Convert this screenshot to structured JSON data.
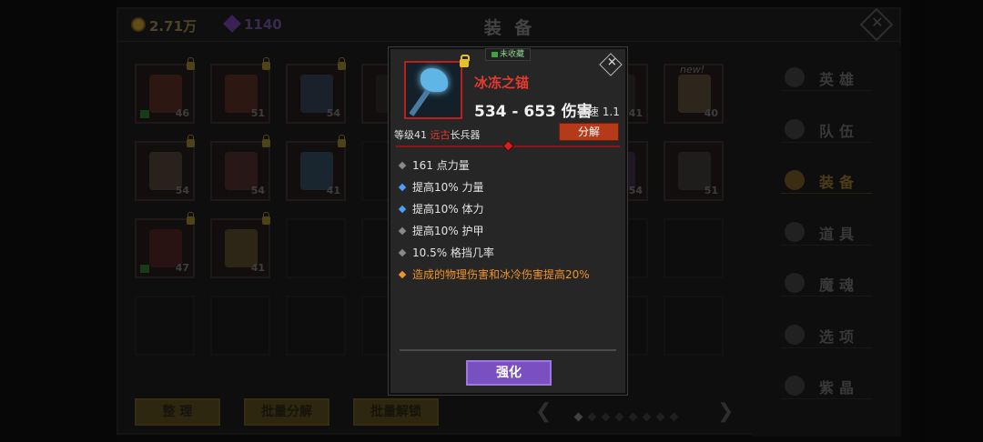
{
  "header": {
    "gold": "2.71万",
    "gems": "1140",
    "title": "装 备"
  },
  "inventory": {
    "slots": [
      {
        "level": "46",
        "locked": true,
        "fav": true,
        "color": "#7a3a2a"
      },
      {
        "level": "51",
        "locked": true,
        "fav": false,
        "color": "#7a3a2a"
      },
      {
        "level": "54",
        "locked": true,
        "fav": false,
        "color": "#3a5a7a"
      },
      {
        "level": "",
        "locked": true,
        "fav": false,
        "color": "#333333"
      },
      {
        "level": "41",
        "locked": false,
        "fav": false,
        "color": "#3a3a3a"
      },
      {
        "level": "40",
        "locked": false,
        "fav": false,
        "color": "#7a6a4a"
      },
      {
        "level": "54",
        "locked": true,
        "fav": false,
        "color": "#6a5a4a"
      },
      {
        "level": "54",
        "locked": true,
        "fav": false,
        "color": "#6a3a3a"
      },
      {
        "level": "41",
        "locked": true,
        "fav": false,
        "color": "#3a6a8a"
      },
      {
        "level": "54",
        "locked": false,
        "fav": false,
        "color": "#4a3a5a"
      },
      {
        "level": "51",
        "locked": false,
        "fav": false,
        "color": "#4a4a4a"
      },
      {
        "level": "47",
        "locked": true,
        "fav": true,
        "color": "#6a2a2a"
      },
      {
        "level": "41",
        "locked": true,
        "fav": false,
        "color": "#7a6a3a"
      }
    ],
    "new_badge": "new!"
  },
  "bottom": {
    "sort_label": "整 理",
    "bulk_dismantle_label": "批量分解",
    "bulk_unlock_label": "批量解锁"
  },
  "sidebar": {
    "items": [
      {
        "label": "英雄",
        "icon": "heroes-icon"
      },
      {
        "label": "队伍",
        "icon": "flag-icon"
      },
      {
        "label": "装备",
        "icon": "helmet-icon"
      },
      {
        "label": "道具",
        "icon": "bag-icon"
      },
      {
        "label": "魔魂",
        "icon": "flame-icon"
      },
      {
        "label": "选项",
        "icon": "gear-icon"
      },
      {
        "label": "紫晶",
        "icon": "crystal-icon"
      }
    ],
    "active_index": 2
  },
  "popup": {
    "fav_status": "未收藏",
    "item_name": "冰冻之锚",
    "damage": "534 - 653 伤害",
    "attack_speed": "攻速 1.1",
    "level_prefix": "等级41",
    "rarity": "远古",
    "item_type": "长兵器",
    "dismantle_label": "分解",
    "stats": [
      {
        "text": "161 点力量",
        "kind": "base"
      },
      {
        "text": "提高10% 力量",
        "kind": "blue"
      },
      {
        "text": "提高10% 体力",
        "kind": "blue"
      },
      {
        "text": "提高10% 护甲",
        "kind": "base"
      },
      {
        "text": "10.5% 格挡几率",
        "kind": "base"
      },
      {
        "text": "造成的物理伤害和冰冷伤害提高20%",
        "kind": "orange"
      }
    ],
    "upgrade_label": "强化"
  },
  "colors": {
    "rarity_red": "#e63a2e",
    "legendary_orange": "#f0912a",
    "affix_blue": "#4aa0ff",
    "upgrade_purple": "#7a50c0"
  }
}
